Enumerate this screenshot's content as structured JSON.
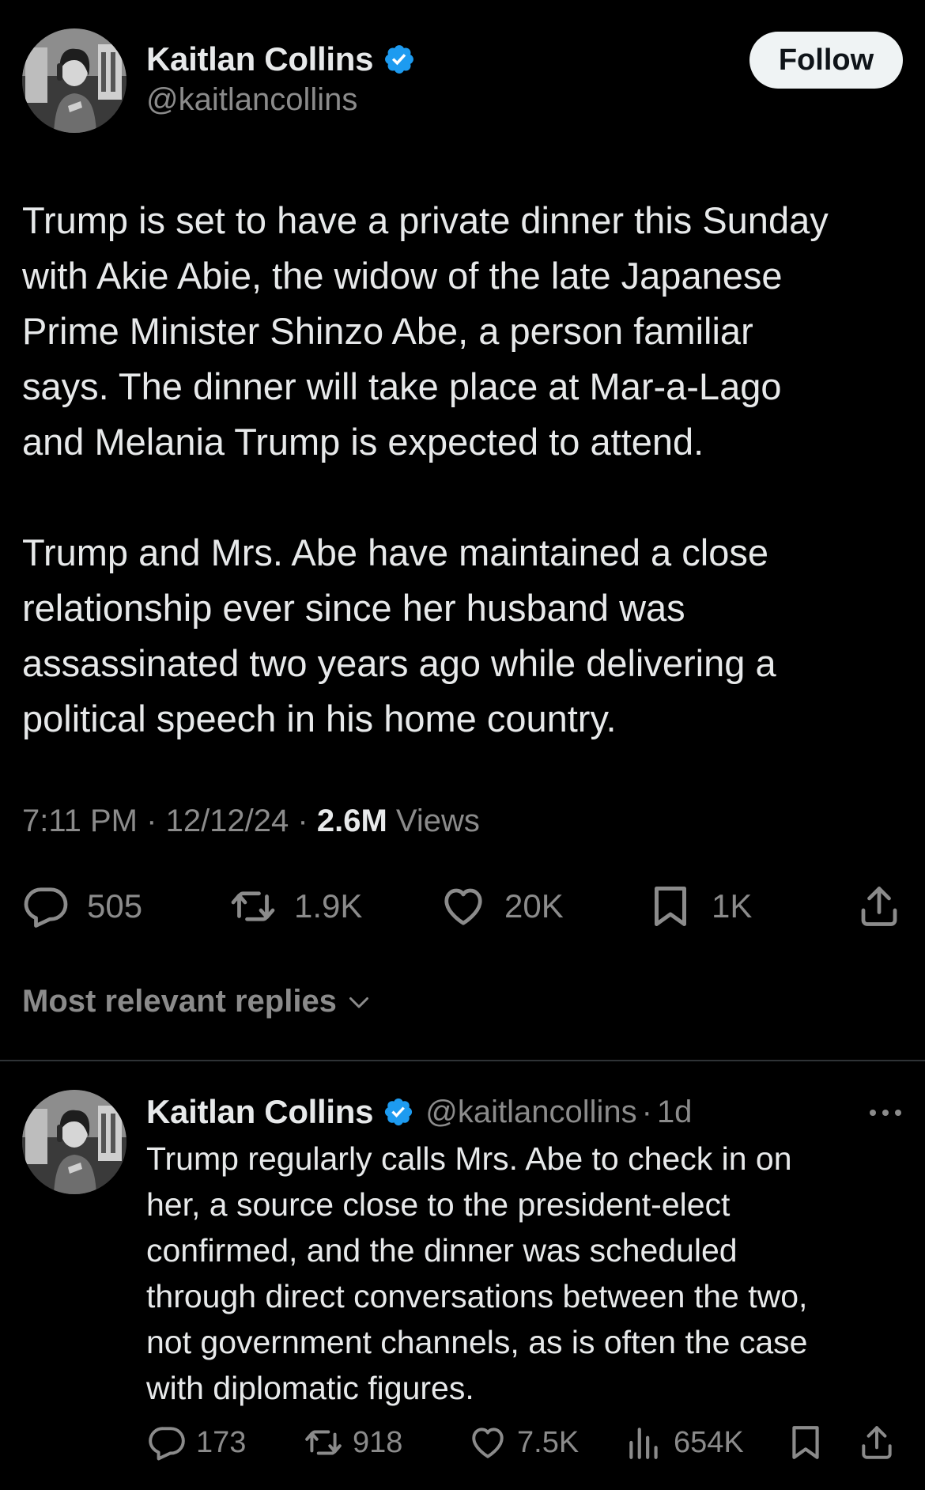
{
  "tweet": {
    "author": {
      "name": "Kaitlan Collins",
      "handle": "@kaitlancollins",
      "verified": true
    },
    "follow_label": "Follow",
    "paragraphs": [
      "Trump is set to have a private dinner this Sunday\nwith Akie Abie, the widow of the late Japanese\nPrime Minister Shinzo Abe, a person familiar\nsays. The dinner will take place at Mar-a-Lago\nand Melania Trump is expected to attend.",
      "Trump and Mrs. Abe have maintained a close\nrelationship ever since her husband was\nassassinated two years ago while delivering a\npolitical speech in his home country."
    ],
    "meta": {
      "time": "7:11 PM",
      "separator": "·",
      "date": "12/12/24",
      "views_count": "2.6M",
      "views_label": "Views"
    },
    "actions": {
      "replies": "505",
      "reposts": "1.9K",
      "likes": "20K",
      "bookmarks": "1K"
    }
  },
  "replies_section": {
    "label": "Most relevant replies"
  },
  "reply": {
    "author": {
      "name": "Kaitlan Collins",
      "handle": "@kaitlancollins",
      "verified": true
    },
    "separator": "·",
    "time": "1d",
    "text": "Trump regularly calls Mrs. Abe to check in on\nher, a source close to the president-elect\nconfirmed, and the dinner was scheduled\nthrough direct conversations between the two,\nnot government channels, as is often the case\nwith diplomatic figures.",
    "actions": {
      "replies": "173",
      "reposts": "918",
      "likes": "7.5K",
      "views": "654K"
    }
  },
  "icons": {
    "verified": "verified-badge-icon",
    "reply": "reply-bubble-icon",
    "repost": "repost-icon",
    "like": "heart-icon",
    "bookmark": "bookmark-icon",
    "share": "share-icon",
    "views": "views-chart-icon",
    "more": "more-dots-icon",
    "chevron": "chevron-down-icon"
  },
  "colors": {
    "background": "#000000",
    "text_primary": "#e7e9ea",
    "text_secondary": "#8b8b8b",
    "verified_blue": "#1d9bf0",
    "follow_bg": "#eff3f4",
    "divider": "#2f3336"
  }
}
